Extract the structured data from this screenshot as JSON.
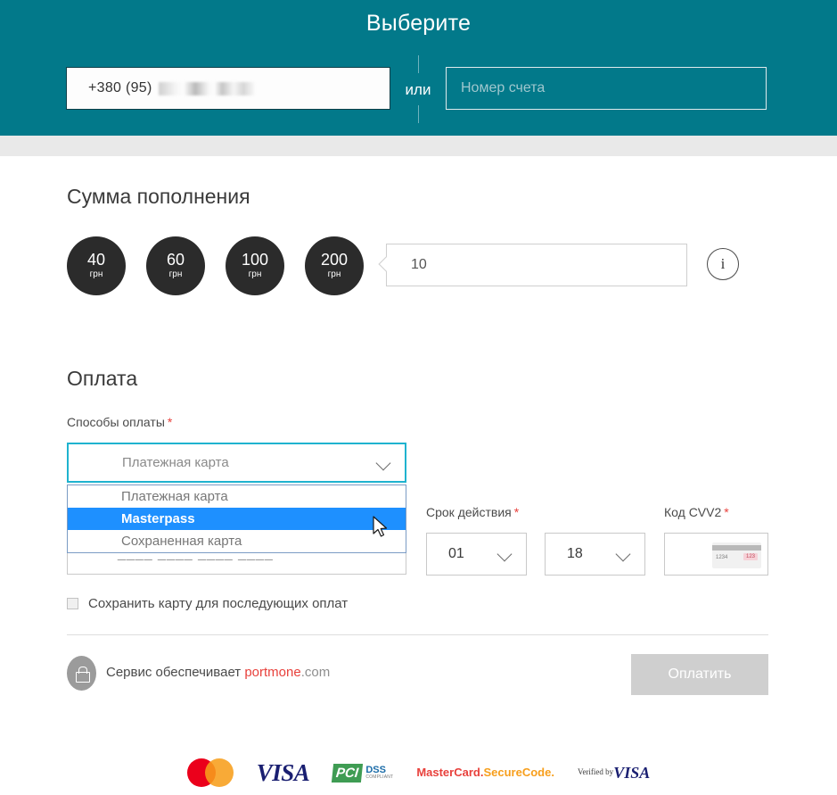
{
  "header": {
    "title": "Выберите",
    "phone_value": "+380 (95)",
    "phone_masked_note": "",
    "or_label": "или",
    "account_placeholder": "Номер счета"
  },
  "amount_section": {
    "title": "Сумма пополнения",
    "chips": [
      {
        "value": "40",
        "unit": "грн"
      },
      {
        "value": "60",
        "unit": "грн"
      },
      {
        "value": "100",
        "unit": "грн"
      },
      {
        "value": "200",
        "unit": "грн"
      }
    ],
    "amount_value": "10",
    "info_icon_glyph": "i"
  },
  "payment_section": {
    "title": "Оплата",
    "method_label": "Способы оплаты",
    "required_mark": "*",
    "method_selected": "Платежная карта",
    "method_options": [
      {
        "label": "Платежная карта",
        "selected": false
      },
      {
        "label": "Masterpass",
        "selected": true
      },
      {
        "label": "Сохраненная карта",
        "selected": false
      }
    ],
    "card_number_placeholder": "____ ____ ____ ____",
    "expiry_label": "Срок действия",
    "expiry_month": "01",
    "expiry_year": "18",
    "cvv_label": "Код CVV2",
    "cvv_card_number": "1234",
    "cvv_card_code": "123",
    "save_card_label": "Сохранить карту для последующих оплат"
  },
  "footer": {
    "service_prefix": "Сервис обеспечивает ",
    "brand_name": "portmone",
    "brand_domain": ".com",
    "pay_button": "Оплатить"
  },
  "logos": {
    "visa": "VISA",
    "pci_badge": "PCI",
    "pci_dss": "DSS",
    "pci_compliant": "COMPLIANT",
    "securecode_top": "MasterCard.",
    "securecode_bottom": "SecureCode.",
    "vbv_top": "Verified by",
    "vbv_bottom": "VISA"
  },
  "colors": {
    "header_teal": "#02798a",
    "accent_focus": "#1fb3cf",
    "highlight_blue": "#1e90ff",
    "required_red": "#e8413c",
    "chip_dark": "#2b2b2b",
    "disabled_gray": "#cfcfcf"
  }
}
